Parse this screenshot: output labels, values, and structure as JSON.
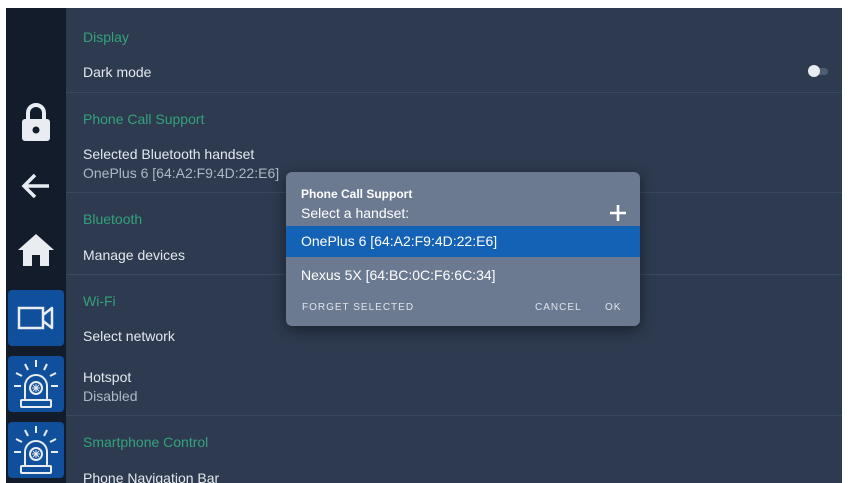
{
  "rail": {
    "buttons": [
      {
        "icon": "lock-icon"
      },
      {
        "icon": "back-arrow-icon"
      },
      {
        "icon": "home-icon"
      },
      {
        "icon": "video-camera-icon",
        "active": true
      },
      {
        "icon": "emergency-beacon-icon"
      },
      {
        "icon": "emergency-beacon-icon"
      }
    ]
  },
  "settings": {
    "display": {
      "title": "Display",
      "dark_mode": "Dark mode",
      "dark_mode_on": false
    },
    "phone_call": {
      "title": "Phone Call Support",
      "handset_label": "Selected Bluetooth handset",
      "handset_value": "OnePlus 6 [64:A2:F9:4D:22:E6]"
    },
    "bluetooth": {
      "title": "Bluetooth",
      "manage": "Manage devices"
    },
    "wifi": {
      "title": "Wi-Fi",
      "select": "Select network"
    },
    "hotspot": {
      "label": "Hotspot",
      "value": "Disabled"
    },
    "smartphone": {
      "title": "Smartphone Control",
      "nav_bar": "Phone Navigation Bar"
    }
  },
  "dialog": {
    "title": "Phone Call Support",
    "subtitle": "Select a handset:",
    "add_icon": "plus-icon",
    "items": [
      {
        "label": "OnePlus 6 [64:A2:F9:4D:22:E6]",
        "selected": true
      },
      {
        "label": "Nexus 5X [64:BC:0C:F6:6C:34]",
        "selected": false
      }
    ],
    "forget": "FORGET SELECTED",
    "cancel": "CANCEL",
    "ok": "OK"
  },
  "colors": {
    "background": "#2d3a4f",
    "rail": "#121c2b",
    "section_title": "#34a27c",
    "dialog": "#6b7991",
    "selection": "#1462b5"
  }
}
